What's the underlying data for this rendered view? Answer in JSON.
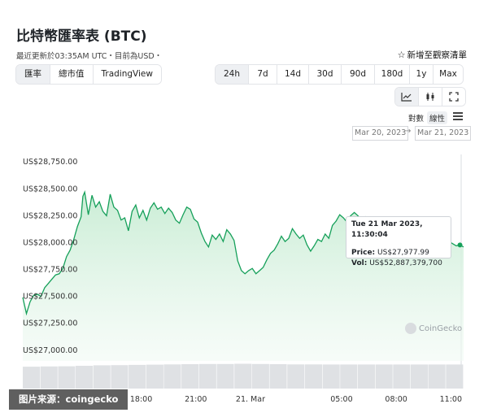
{
  "header": {
    "title": "比特幣匯率表 (BTC)",
    "subtitle": "最近更新於03:35AM UTC・目前為USD・",
    "watchlist_label": "新增至觀察清單"
  },
  "view_tabs": [
    {
      "label": "匯率",
      "active": true
    },
    {
      "label": "總市值",
      "active": false
    },
    {
      "label": "TradingView",
      "active": false
    }
  ],
  "range_tabs": [
    {
      "label": "24h",
      "active": true
    },
    {
      "label": "7d",
      "active": false
    },
    {
      "label": "14d",
      "active": false
    },
    {
      "label": "30d",
      "active": false
    },
    {
      "label": "90d",
      "active": false
    },
    {
      "label": "180d",
      "active": false
    },
    {
      "label": "1y",
      "active": false
    },
    {
      "label": "Max",
      "active": false
    }
  ],
  "chart_type_icons": [
    "line-chart-icon",
    "candlestick-icon",
    "fullscreen-icon"
  ],
  "scale": {
    "log_label": "對數",
    "linear_label": "線性",
    "selected": "linear"
  },
  "date_range": {
    "from": "Mar 20, 2023",
    "arrow": "→",
    "to": "Mar 21, 2023"
  },
  "tooltip": {
    "date": "Tue 21 Mar 2023, 11:30:04",
    "price_label": "Price:",
    "price_value": "US$27,977.99",
    "vol_label": "Vol:",
    "vol_value": "US$52,887,379,700"
  },
  "logo_text": "CoinGecko",
  "credit": "图片来源：coingecko",
  "colors": {
    "line": "#16a05a",
    "fill_top": "#c7ecd3",
    "volume": "#dfe1e4"
  },
  "chart_data": {
    "type": "area",
    "title": "",
    "xlabel": "",
    "ylabel": "",
    "ylim": [
      26900,
      28850
    ],
    "yticks": [
      27000,
      27250,
      27500,
      27750,
      28000,
      28250,
      28500,
      28750
    ],
    "ytick_labels": [
      "US$27,000.00",
      "US$27,250.00",
      "US$27,500.00",
      "US$27,750.00",
      "US$28,000.00",
      "US$28,250.00",
      "US$28,500.00",
      "US$28,750.00"
    ],
    "xlim_hours": [
      11.5,
      35.7
    ],
    "xticks": [
      {
        "hour": 18,
        "label": "18:00"
      },
      {
        "hour": 21,
        "label": "21:00"
      },
      {
        "hour": 24,
        "label": "21. Mar"
      },
      {
        "hour": 29,
        "label": "05:00"
      },
      {
        "hour": 32,
        "label": "08:00"
      },
      {
        "hour": 35,
        "label": "11:00"
      }
    ],
    "series": [
      {
        "points": [
          [
            11.5,
            27490
          ],
          [
            11.7,
            27340
          ],
          [
            11.9,
            27450
          ],
          [
            12.1,
            27510
          ],
          [
            12.3,
            27520
          ],
          [
            12.5,
            27500
          ],
          [
            12.7,
            27580
          ],
          [
            12.9,
            27620
          ],
          [
            13.1,
            27660
          ],
          [
            13.3,
            27700
          ],
          [
            13.5,
            27710
          ],
          [
            13.7,
            27760
          ],
          [
            13.9,
            27870
          ],
          [
            14.1,
            27930
          ],
          [
            14.3,
            28030
          ],
          [
            14.5,
            28150
          ],
          [
            14.7,
            28240
          ],
          [
            14.8,
            28430
          ],
          [
            14.9,
            28470
          ],
          [
            15.1,
            28260
          ],
          [
            15.3,
            28440
          ],
          [
            15.5,
            28330
          ],
          [
            15.7,
            28380
          ],
          [
            15.9,
            28290
          ],
          [
            16.1,
            28250
          ],
          [
            16.3,
            28450
          ],
          [
            16.5,
            28330
          ],
          [
            16.7,
            28300
          ],
          [
            16.9,
            28210
          ],
          [
            17.1,
            28230
          ],
          [
            17.3,
            28110
          ],
          [
            17.5,
            28290
          ],
          [
            17.7,
            28350
          ],
          [
            17.9,
            28230
          ],
          [
            18.1,
            28300
          ],
          [
            18.3,
            28210
          ],
          [
            18.5,
            28320
          ],
          [
            18.7,
            28370
          ],
          [
            18.9,
            28310
          ],
          [
            19.1,
            28330
          ],
          [
            19.3,
            28270
          ],
          [
            19.5,
            28320
          ],
          [
            19.7,
            28280
          ],
          [
            19.9,
            28210
          ],
          [
            20.1,
            28180
          ],
          [
            20.3,
            28260
          ],
          [
            20.5,
            28330
          ],
          [
            20.7,
            28310
          ],
          [
            20.9,
            28220
          ],
          [
            21.1,
            28190
          ],
          [
            21.3,
            28090
          ],
          [
            21.5,
            28010
          ],
          [
            21.7,
            27960
          ],
          [
            21.9,
            28070
          ],
          [
            22.1,
            28030
          ],
          [
            22.3,
            28080
          ],
          [
            22.5,
            28010
          ],
          [
            22.7,
            28120
          ],
          [
            22.9,
            28080
          ],
          [
            23.1,
            28020
          ],
          [
            23.3,
            27830
          ],
          [
            23.5,
            27740
          ],
          [
            23.7,
            27710
          ],
          [
            23.9,
            27740
          ],
          [
            24.1,
            27760
          ],
          [
            24.3,
            27710
          ],
          [
            24.5,
            27740
          ],
          [
            24.7,
            27770
          ],
          [
            24.9,
            27840
          ],
          [
            25.1,
            27900
          ],
          [
            25.3,
            27930
          ],
          [
            25.5,
            27990
          ],
          [
            25.7,
            28060
          ],
          [
            25.9,
            28010
          ],
          [
            26.1,
            28040
          ],
          [
            26.3,
            28130
          ],
          [
            26.5,
            28080
          ],
          [
            26.7,
            28040
          ],
          [
            26.9,
            28070
          ],
          [
            27.1,
            27980
          ],
          [
            27.3,
            27920
          ],
          [
            27.5,
            27970
          ],
          [
            27.7,
            28030
          ],
          [
            27.9,
            28010
          ],
          [
            28.1,
            28080
          ],
          [
            28.3,
            28040
          ],
          [
            28.5,
            28160
          ],
          [
            28.7,
            28200
          ],
          [
            28.9,
            28260
          ],
          [
            29.1,
            28230
          ],
          [
            29.3,
            28190
          ],
          [
            29.5,
            28250
          ],
          [
            29.7,
            28280
          ],
          [
            29.9,
            28250
          ],
          [
            30.1,
            28210
          ],
          [
            30.3,
            28240
          ],
          [
            30.5,
            28200
          ],
          [
            30.7,
            28230
          ],
          [
            30.9,
            28060
          ],
          [
            31.1,
            28030
          ],
          [
            31.3,
            28040
          ],
          [
            31.5,
            28100
          ],
          [
            31.7,
            28090
          ],
          [
            31.9,
            28130
          ],
          [
            32.1,
            28060
          ],
          [
            32.3,
            28090
          ],
          [
            32.5,
            28020
          ],
          [
            32.7,
            28050
          ],
          [
            32.9,
            28010
          ],
          [
            33.1,
            28040
          ],
          [
            33.3,
            28030
          ],
          [
            33.5,
            28000
          ],
          [
            33.7,
            28060
          ],
          [
            33.9,
            28020
          ],
          [
            34.1,
            28030
          ],
          [
            34.3,
            28000
          ],
          [
            34.5,
            28020
          ],
          [
            34.7,
            28000
          ],
          [
            34.9,
            28010
          ],
          [
            35.1,
            27990
          ],
          [
            35.3,
            27970
          ],
          [
            35.5,
            27977.99
          ],
          [
            35.7,
            27960
          ]
        ]
      }
    ],
    "volume": {
      "ylim": [
        0,
        60000000000
      ],
      "x_hours": [
        11.5,
        12.5,
        13.5,
        14.5,
        15.5,
        16.5,
        17.5,
        18.5,
        19.5,
        20.5,
        21.5,
        22.5,
        23.5,
        24.5,
        25.5,
        26.5,
        27.5,
        28.5,
        29.5,
        30.5,
        31.5,
        32.5,
        33.5,
        34.5,
        35.5
      ],
      "values": [
        48000000000,
        48500000000,
        49000000000,
        50000000000,
        51000000000,
        51500000000,
        52000000000,
        52500000000,
        53000000000,
        53500000000,
        54000000000,
        54000000000,
        54500000000,
        54000000000,
        53500000000,
        53000000000,
        53000000000,
        52800000000,
        52800000000,
        52900000000,
        52900000000,
        52900000000,
        52900000000,
        52887379700,
        52887379700
      ]
    },
    "highlight": {
      "hour": 35.5,
      "value": 27977.99
    },
    "grid": false,
    "legend": "none"
  }
}
